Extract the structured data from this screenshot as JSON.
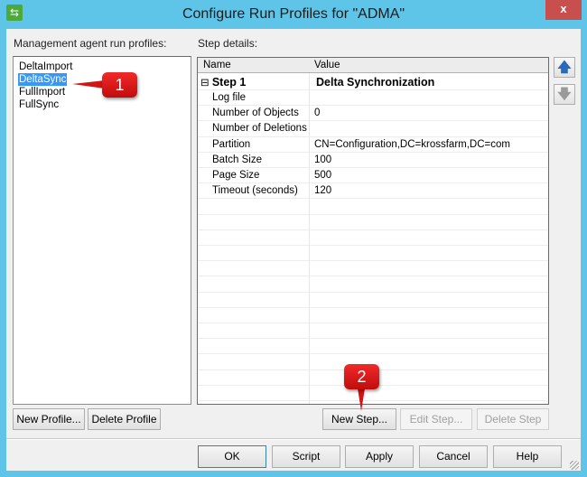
{
  "window": {
    "title": "Configure Run Profiles for \"ADMA\"",
    "close_label": "x"
  },
  "profiles": {
    "label": "Management agent run profiles:",
    "items": [
      "DeltaImport",
      "DeltaSync",
      "FullImport",
      "FullSync"
    ],
    "selected": "DeltaSync"
  },
  "step_details": {
    "label": "Step details:",
    "columns": [
      "Name",
      "Value"
    ],
    "step": {
      "name": "Step 1",
      "value": "Delta Synchronization",
      "expander": "⊟"
    },
    "rows": [
      {
        "name": "Log file",
        "value": ""
      },
      {
        "name": "Number of Objects",
        "value": "0"
      },
      {
        "name": "Number of Deletions",
        "value": ""
      },
      {
        "name": "Partition",
        "value": "CN=Configuration,DC=krossfarm,DC=com"
      },
      {
        "name": "Batch Size",
        "value": "100"
      },
      {
        "name": "Page Size",
        "value": "500"
      },
      {
        "name": "Timeout (seconds)",
        "value": "120"
      }
    ]
  },
  "buttons": {
    "new_profile": "New Profile...",
    "delete_profile": "Delete Profile",
    "new_step": "New Step...",
    "edit_step": "Edit Step...",
    "delete_step": "Delete Step",
    "ok": "OK",
    "script": "Script",
    "apply": "Apply",
    "cancel": "Cancel",
    "help": "Help",
    "move_up": "🡅",
    "move_down": "🡇"
  },
  "callouts": [
    "1",
    "2"
  ]
}
